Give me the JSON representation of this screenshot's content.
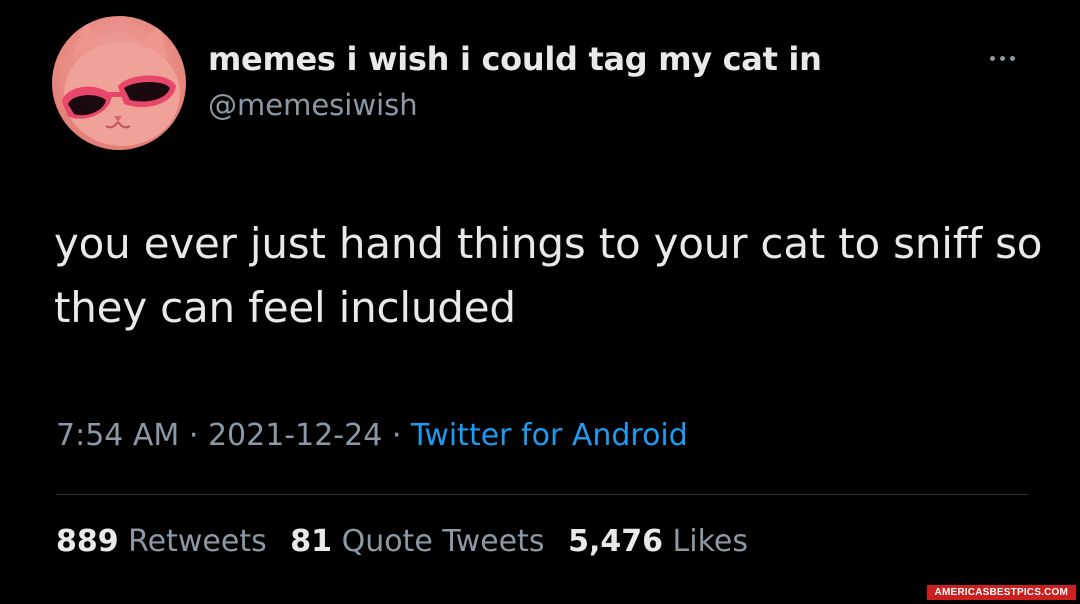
{
  "user": {
    "display_name": "memes i wish i could tag my cat in",
    "handle": "@memesiwish",
    "avatar_icon": "cat-with-sunglasses-avatar"
  },
  "more_icon": "more-horizontal-icon",
  "tweet": {
    "text": "you ever just hand things to your cat to sniff so they can feel included"
  },
  "meta": {
    "time": "7:54 AM",
    "separator": "·",
    "date": "2021-12-24",
    "source": "Twitter for Android"
  },
  "stats": {
    "retweets_count": "889",
    "retweets_label": "Retweets",
    "quotes_count": "81",
    "quotes_label": "Quote Tweets",
    "likes_count": "5,476",
    "likes_label": "Likes"
  },
  "watermark": "AMERICASBESTPICS.COM",
  "colors": {
    "background": "#000000",
    "text": "#e7e9ea",
    "secondary": "#8b98a5",
    "link": "#1d9bf0",
    "watermark_bg": "#cc1f1f"
  }
}
